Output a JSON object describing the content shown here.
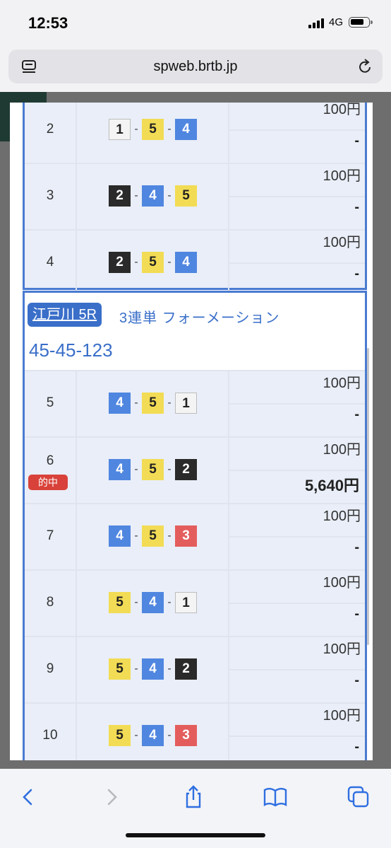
{
  "status": {
    "time": "12:53",
    "network": "4G"
  },
  "browser": {
    "url": "spweb.brtb.jp"
  },
  "top_rows": [
    {
      "num": "2",
      "combo": [
        {
          "n": "1",
          "c": "c1"
        },
        {
          "n": "5",
          "c": "c5"
        },
        {
          "n": "4",
          "c": "c4"
        }
      ],
      "stake": "100円",
      "ret": "-"
    },
    {
      "num": "3",
      "combo": [
        {
          "n": "2",
          "c": "c2"
        },
        {
          "n": "4",
          "c": "c4"
        },
        {
          "n": "5",
          "c": "c5"
        }
      ],
      "stake": "100円",
      "ret": "-"
    },
    {
      "num": "4",
      "combo": [
        {
          "n": "2",
          "c": "c2"
        },
        {
          "n": "5",
          "c": "c5"
        },
        {
          "n": "4",
          "c": "c4"
        }
      ],
      "stake": "100円",
      "ret": "-"
    }
  ],
  "section": {
    "venue": "江戸川 5R",
    "bet_type": "3連単 フォーメーション",
    "combination": "45-45-123"
  },
  "hit_label": "的中",
  "rows": [
    {
      "num": "5",
      "combo": [
        {
          "n": "4",
          "c": "c4"
        },
        {
          "n": "5",
          "c": "c5"
        },
        {
          "n": "1",
          "c": "c1"
        }
      ],
      "stake": "100円",
      "ret": "-"
    },
    {
      "num": "6",
      "hit": true,
      "combo": [
        {
          "n": "4",
          "c": "c4"
        },
        {
          "n": "5",
          "c": "c5"
        },
        {
          "n": "2",
          "c": "c2"
        }
      ],
      "stake": "100円",
      "ret": "5,640円"
    },
    {
      "num": "7",
      "combo": [
        {
          "n": "4",
          "c": "c4"
        },
        {
          "n": "5",
          "c": "c5"
        },
        {
          "n": "3",
          "c": "c3"
        }
      ],
      "stake": "100円",
      "ret": "-"
    },
    {
      "num": "8",
      "combo": [
        {
          "n": "5",
          "c": "c5"
        },
        {
          "n": "4",
          "c": "c4"
        },
        {
          "n": "1",
          "c": "c1"
        }
      ],
      "stake": "100円",
      "ret": "-"
    },
    {
      "num": "9",
      "combo": [
        {
          "n": "5",
          "c": "c5"
        },
        {
          "n": "4",
          "c": "c4"
        },
        {
          "n": "2",
          "c": "c2"
        }
      ],
      "stake": "100円",
      "ret": "-"
    },
    {
      "num": "10",
      "combo": [
        {
          "n": "5",
          "c": "c5"
        },
        {
          "n": "4",
          "c": "c4"
        },
        {
          "n": "3",
          "c": "c3"
        }
      ],
      "stake": "100円",
      "ret": "-"
    }
  ],
  "toolbar": {
    "back": "chevron-left-icon",
    "forward": "chevron-right-icon",
    "share": "share-icon",
    "bookmarks": "book-icon",
    "tabs": "tabs-icon"
  }
}
